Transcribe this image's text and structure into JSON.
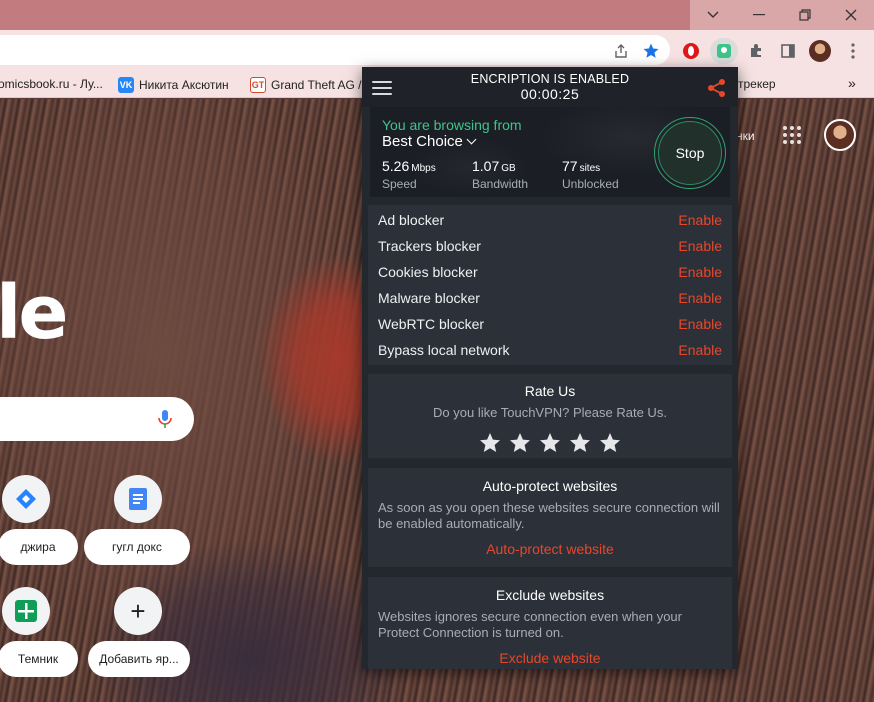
{
  "browser": {
    "window_controls": {
      "minimize": "—",
      "tabsearch": "⌄",
      "restore": "⧉",
      "close": "✕"
    },
    "toolbar_icons": [
      "share-icon",
      "star-icon",
      "opera-icon",
      "touchvpn-icon",
      "extensions-icon",
      "sidepanel-icon",
      "profile-avatar",
      "kebab-menu-icon"
    ],
    "bookmarks": [
      {
        "label": "omicsbook.ru - Лу...",
        "icon": "",
        "color": "#f6e2e2"
      },
      {
        "label": "Никита Аксютин",
        "icon": "VK",
        "color": "#2787f5"
      },
      {
        "label": "Grand Theft AG / ...",
        "icon": "GT",
        "color": "#d44a2a"
      },
      {
        "label": "трекер",
        "icon": "",
        "color": "#f6e2e2"
      }
    ],
    "bookmarks_more": "»"
  },
  "newtab": {
    "logo_fragment": "le",
    "side_text": "нки",
    "shortcuts": [
      {
        "label": "джира",
        "icon": "jira-icon"
      },
      {
        "label": "гугл докс",
        "icon": "google-docs-icon"
      },
      {
        "label": "Темник",
        "icon": "google-sheets-icon"
      },
      {
        "label": "Добавить яр...",
        "icon": "plus-icon",
        "glyph": "+"
      }
    ]
  },
  "vpn": {
    "header": {
      "title": "ENCRIPTION IS ENABLED",
      "timer": "00:00:25"
    },
    "status": {
      "browsing_from": "You are browsing from",
      "location": "Best Choice",
      "speed_value": "5.26",
      "speed_unit": "Mbps",
      "speed_label": "Speed",
      "bandwidth_value": "1.07",
      "bandwidth_unit": "GB",
      "bandwidth_label": "Bandwidth",
      "sites_value": "77",
      "sites_unit": "sites",
      "sites_label": "Unblocked",
      "stop_label": "Stop"
    },
    "blockers": [
      {
        "name": "Ad blocker",
        "action": "Enable"
      },
      {
        "name": "Trackers blocker",
        "action": "Enable"
      },
      {
        "name": "Cookies blocker",
        "action": "Enable"
      },
      {
        "name": "Malware blocker",
        "action": "Enable"
      },
      {
        "name": "WebRTC blocker",
        "action": "Enable"
      },
      {
        "name": "Bypass local network",
        "action": "Enable"
      }
    ],
    "rate": {
      "title": "Rate Us",
      "subtitle": "Do you like TouchVPN? Please Rate Us.",
      "stars": 5
    },
    "auto_protect": {
      "title": "Auto-protect websites",
      "description": "As soon as you open these websites secure connection will be enabled automatically.",
      "link": "Auto-protect website"
    },
    "exclude": {
      "title": "Exclude websites",
      "description": "Websites ignores secure connection even when your Protect Connection is turned on.",
      "link": "Exclude website"
    },
    "colors": {
      "accent_green": "#3ec48a",
      "accent_red": "#e8472a",
      "panel": "#23272e",
      "card": "#2c3139"
    }
  }
}
